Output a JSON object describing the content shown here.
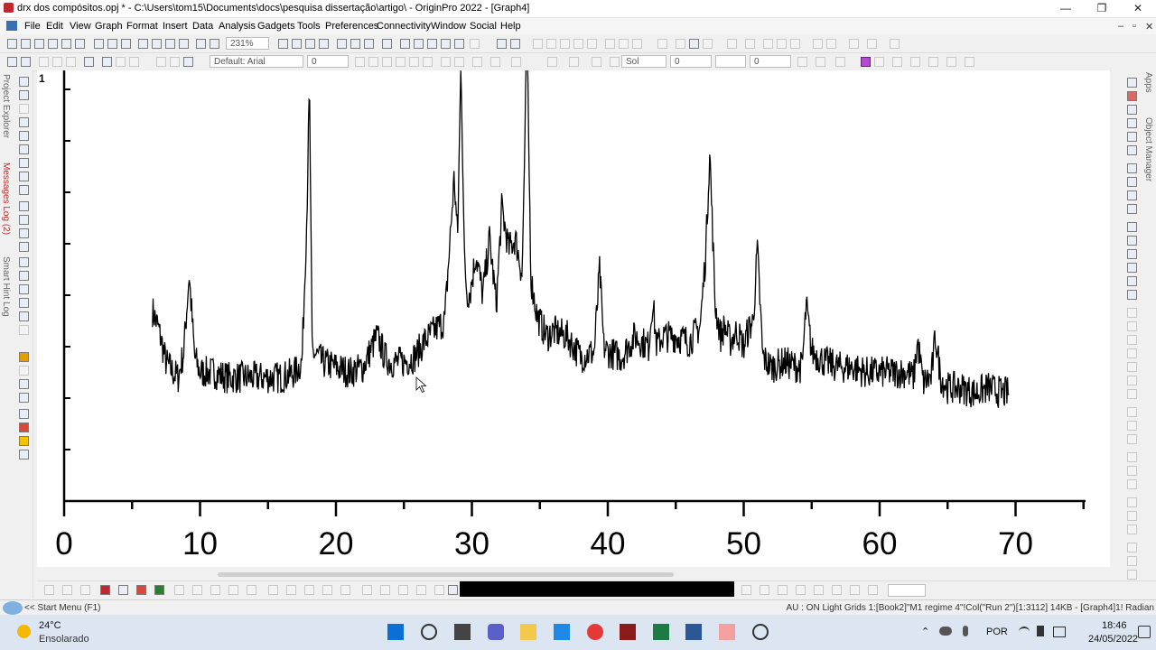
{
  "window": {
    "title": "drx dos compósitos.opj * - C:\\Users\\tom15\\Documents\\docs\\pesquisa dissertação\\artigo\\ - OriginPro 2022 - [Graph4]",
    "controls": {
      "minimize": "—",
      "maximize": "❐",
      "close": "✕"
    }
  },
  "menu": [
    "File",
    "Edit",
    "View",
    "Graph",
    "Format",
    "Insert",
    "Data",
    "Analysis",
    "Gadgets",
    "Tools",
    "Preferences",
    "Connectivity",
    "Window",
    "Social",
    "Help"
  ],
  "mdi_controls": {
    "minimize": "–",
    "restore": "▫",
    "close": "✕"
  },
  "toolbar": {
    "zoom": "231%",
    "font": "Default: Arial",
    "font_size": "0",
    "line_style": "Sol",
    "line_width": "0",
    "size2": "0"
  },
  "left_panels": [
    "Project Explorer",
    "Messages Log (2)",
    "Smart Hint Log"
  ],
  "right_panels": [
    "Apps",
    "Object Manager"
  ],
  "graph": {
    "layer_label": "1"
  },
  "chart_data": {
    "type": "line",
    "title": "",
    "xlabel": "",
    "ylabel": "",
    "xlim": [
      0,
      75
    ],
    "x_ticks": [
      "0",
      "10",
      "20",
      "30",
      "40",
      "50",
      "60",
      "70"
    ],
    "x_range": [
      6.5,
      69.5
    ],
    "series": [
      {
        "x": [
          6.5,
          6.9,
          7.5,
          8.0,
          8.4,
          8.8,
          9.2,
          9.6,
          10.0,
          11,
          12,
          13,
          14,
          15,
          16,
          17,
          17.5,
          17.85,
          18.05,
          18.25,
          18.7,
          19,
          20,
          21,
          22,
          23,
          23.2,
          23.6,
          24,
          25,
          25.8,
          26.5,
          27.2,
          28,
          28.7,
          28.95,
          29.2,
          29.45,
          29.65,
          29.9,
          30.3,
          30.8,
          31.3,
          31.8,
          32.2,
          32.7,
          33.2,
          33.7,
          34.05,
          34.35,
          34.8,
          35.5,
          36,
          37,
          38,
          39,
          39.4,
          39.7,
          40,
          41,
          42,
          43,
          43.3,
          43.6,
          44,
          45,
          46,
          46.8,
          47.2,
          47.5,
          47.9,
          48.3,
          48.6,
          49,
          49.5,
          50,
          50.3,
          50.7,
          51,
          51.4,
          52,
          53,
          54,
          54.3,
          54.6,
          55,
          56,
          57,
          58,
          59,
          60,
          61,
          62,
          62.5,
          62.8,
          63.2,
          63.8,
          64.1,
          64.5,
          65,
          66,
          67,
          68,
          69,
          69.5
        ],
        "y": [
          37,
          34,
          27,
          25,
          24,
          29,
          44,
          28,
          25,
          25,
          24,
          24,
          24,
          24,
          24,
          25,
          27,
          55,
          80,
          29,
          28,
          27,
          26,
          25,
          26,
          32,
          31,
          28,
          27,
          27,
          28,
          31,
          33,
          35,
          63,
          51,
          86,
          47,
          40,
          41,
          48,
          40,
          51,
          38,
          57,
          49,
          51,
          44,
          90,
          43,
          36,
          32,
          33,
          32,
          28,
          29,
          45,
          30,
          29,
          28,
          32,
          30,
          39,
          30,
          32,
          32,
          31,
          34,
          48,
          68,
          38,
          32,
          34,
          31,
          33,
          30,
          33,
          35,
          49,
          28,
          26,
          27,
          26,
          26,
          38,
          29,
          27,
          26,
          26,
          25,
          25,
          25,
          25,
          24,
          31,
          23,
          24,
          32,
          24,
          22,
          22,
          21,
          22,
          21,
          21
        ]
      }
    ],
    "ylim": [
      0,
      84
    ],
    "noise_amplitude": 3.2,
    "grid": false,
    "legend": "none"
  },
  "status": {
    "left": "<< Start Menu (F1)",
    "right": "AU : ON  Light Grids  1:[Book2]\"M1 regime 4\"!Col(\"Run 2\")[1:3112]  14KB - [Graph4]1!  Radian"
  },
  "taskbar": {
    "weather_temp": "24°C",
    "weather_desc": "Ensolarado",
    "language": "POR",
    "time": "18:46",
    "date": "24/05/2022"
  }
}
